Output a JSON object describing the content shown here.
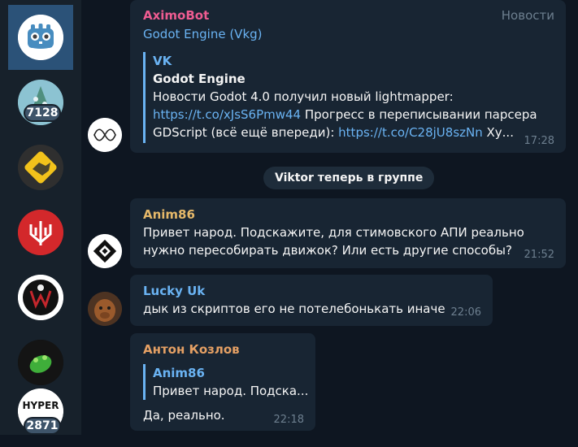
{
  "sidebar": {
    "items": [
      {
        "name": "godot-engine-chat",
        "icon": "godot-logo-icon",
        "active": true
      },
      {
        "name": "snow-tree-chat",
        "badge": "7128"
      },
      {
        "name": "handshake-chat"
      },
      {
        "name": "red-trident-chat"
      },
      {
        "name": "gothic-emblem-chat"
      },
      {
        "name": "green-frog-chat"
      },
      {
        "name": "hyper-chat",
        "label": "HYPER",
        "badge": "2871"
      }
    ]
  },
  "messages": [
    {
      "sender": "AximoBot",
      "via": "Godot Engine (Vkg)",
      "tag": "Новости",
      "quote": {
        "title": "VK",
        "headline": "Godot Engine",
        "line1_text": "Новости  Godot 4.0 получил новый lightmapper:",
        "line2_link": "https://t.co/xJsS6Pmw44",
        "line2_text": " Прогресс в переписывании парсера",
        "line3_text": "GDScript (всё ещё впереди): ",
        "line3_link": "https://t.co/C28jU8szNn",
        "line3_tail": " Ху..."
      },
      "time": "17:28"
    },
    {
      "service": "Viktor теперь в группе"
    },
    {
      "sender": "Anim86",
      "lines": [
        "Привет народ. Подскажите, для стимовского АПИ реально",
        "нужно пересобирать движок? Или есть другие способы?"
      ],
      "time": "21:52"
    },
    {
      "sender": "Lucky Uk",
      "text": "дык из скриптов его не потелебонькать иначе",
      "time": "22:06"
    },
    {
      "sender": "Антон Козлов",
      "reply": {
        "author": "Anim86",
        "text": "Привет народ. Подска..."
      },
      "text": "Да, реально.",
      "time": "22:18"
    }
  ],
  "colors": {
    "background": "#0e1621",
    "sidebar": "#17212b",
    "bubble": "#182533",
    "link": "#6ab3f3",
    "aximobot_name": "#ee5c91",
    "anim86_name": "#e5b869",
    "lucky_name": "#6ab3f3",
    "anton_name": "#e5a064"
  }
}
